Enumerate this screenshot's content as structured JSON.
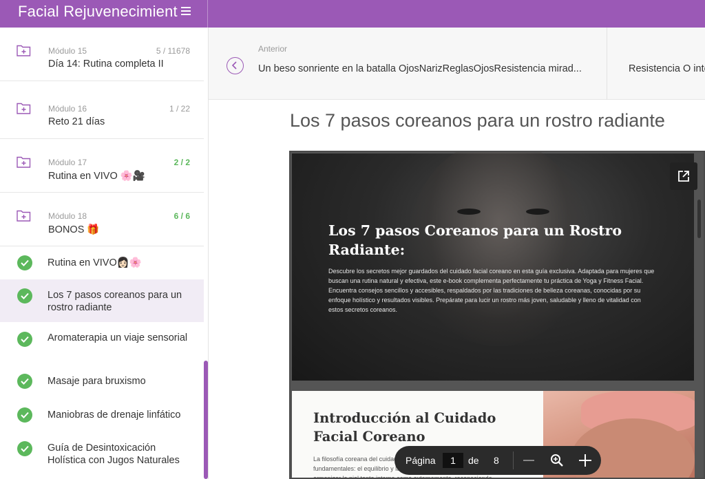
{
  "app": {
    "title": "Facial Rejuvenecimiento"
  },
  "sidebar": {
    "modules": [
      {
        "label": "Módulo 15",
        "count": "5 / 11678",
        "title": "Día 14: Rutina completa II",
        "done": false
      },
      {
        "label": "Módulo 16",
        "count": "1 / 22",
        "title": "Reto 21 días",
        "done": false
      },
      {
        "label": "Módulo 17",
        "count": "2 / 2",
        "title": "Rutina en VIVO 🌸🎥",
        "done": true
      },
      {
        "label": "Módulo 18",
        "count": "6 / 6",
        "title": "BONOS 🎁",
        "done": true
      }
    ],
    "lessons": [
      {
        "title": "Rutina en VIVO👩🏻🌸",
        "active": false
      },
      {
        "title": "Los 7 pasos coreanos para un rostro radiante",
        "active": true
      },
      {
        "title": "Aromaterapia un viaje sensorial",
        "active": false
      },
      {
        "title": "Masaje para bruxismo",
        "active": false
      },
      {
        "title": "Maniobras de drenaje linfático",
        "active": false
      },
      {
        "title": "Guía de Desintoxicación Holística con Jugos Naturales",
        "active": false
      }
    ]
  },
  "nav": {
    "prev_label": "Anterior",
    "prev_title": "Un beso sonriente en la batalla OjosNarizReglasOjosResistencia mirad...",
    "next_title": "Resistencia O inte"
  },
  "content": {
    "title": "Los 7 pasos coreanos para un rostro radiante",
    "hero_title": "Los 7 pasos Coreanos para un Rostro Radiante:",
    "hero_text": "Descubre los secretos mejor guardados del cuidado facial coreano en esta guía exclusiva. Adaptada para mujeres que buscan una rutina natural y efectiva, este e-book complementa perfectamente tu práctica de Yoga y Fitness Facial. Encuentra consejos sencillos y accesibles, respaldados por las tradiciones de belleza coreanas, conocidas por su enfoque holístico y resultados visibles. Prepárate para lucir un rostro más joven, saludable y lleno de vitalidad con estos secretos coreanos.",
    "page2_title": "Introducción al Cuidado Facial Coreano",
    "page2_text": "La filosofía coreana del cuidado facial se basa en dos principios fundamentales: el equilibrio y la constancia. Este enfoque holístico busca armonizar la piel tanto interna como externamente, reconociendo"
  },
  "pager": {
    "label": "Página",
    "current": "1",
    "of": "de",
    "total": "8"
  },
  "colors": {
    "accent": "#9b59b6",
    "success": "#5cb85c"
  },
  "icons": [
    "menu-icon",
    "folder-plus-icon",
    "check-circle-icon",
    "chevron-left-icon",
    "external-link-icon",
    "zoom-in-icon",
    "minus-icon",
    "plus-icon"
  ]
}
